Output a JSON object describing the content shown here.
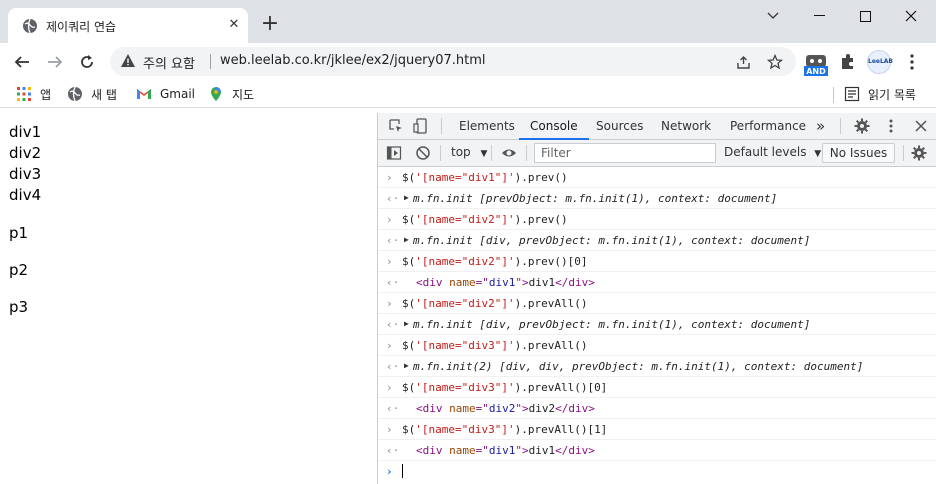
{
  "tab": {
    "title": "제이쿼리 연습"
  },
  "omnibox": {
    "security_label": "주의 요함",
    "url": "web.leelab.co.kr/jklee/ex2/jquery07.html"
  },
  "extensions": {
    "and_label": "AND",
    "profile_label": "LeeLAB"
  },
  "bookmarks": {
    "apps": "앱",
    "newtab": "새 탭",
    "gmail": "Gmail",
    "maps": "지도",
    "reading_list": "읽기 목록"
  },
  "page": {
    "divs": [
      "div1",
      "div2",
      "div3",
      "div4"
    ],
    "paragraphs": [
      "p1",
      "p2",
      "p3"
    ]
  },
  "devtools": {
    "tabs": [
      "Elements",
      "Console",
      "Sources",
      "Network",
      "Performance"
    ],
    "active_tab": "Console",
    "more": "»",
    "context": "top",
    "filter_placeholder": "Filter",
    "levels": "Default levels",
    "issues": "No Issues"
  },
  "console": [
    {
      "kind": "input",
      "a": "$(",
      "s": "'[name=\"div1\"]'",
      "b": ").prev()"
    },
    {
      "kind": "object",
      "text": "m.fn.init [prevObject: m.fn.init(1), context: document]"
    },
    {
      "kind": "input",
      "a": "$(",
      "s": "'[name=\"div2\"]'",
      "b": ").prev()"
    },
    {
      "kind": "object",
      "text": "m.fn.init [div, prevObject: m.fn.init(1), context: document]"
    },
    {
      "kind": "input",
      "a": "$(",
      "s": "'[name=\"div2\"]'",
      "b": ").prev()[0]"
    },
    {
      "kind": "element",
      "open": "<div ",
      "attr": "name",
      "eq": "=\"",
      "val": "div1",
      "close": "\">",
      "content": "div1",
      "end": "</div>"
    },
    {
      "kind": "input",
      "a": "$(",
      "s": "'[name=\"div2\"]'",
      "b": ").prevAll()"
    },
    {
      "kind": "object",
      "text": "m.fn.init [div, prevObject: m.fn.init(1), context: document]"
    },
    {
      "kind": "input",
      "a": "$(",
      "s": "'[name=\"div3\"]'",
      "b": ").prevAll()"
    },
    {
      "kind": "object",
      "text": "m.fn.init(2) [div, div, prevObject: m.fn.init(1), context: document]"
    },
    {
      "kind": "input",
      "a": "$(",
      "s": "'[name=\"div3\"]'",
      "b": ").prevAll()[0]"
    },
    {
      "kind": "element",
      "open": "<div ",
      "attr": "name",
      "eq": "=\"",
      "val": "div2",
      "close": "\">",
      "content": "div2",
      "end": "</div>"
    },
    {
      "kind": "input",
      "a": "$(",
      "s": "'[name=\"div3\"]'",
      "b": ").prevAll()[1]"
    },
    {
      "kind": "element",
      "open": "<div ",
      "attr": "name",
      "eq": "=\"",
      "val": "div1",
      "close": "\">",
      "content": "div1",
      "end": "</div>"
    }
  ],
  "prompt_symbol": "›",
  "result_symbol": "‹·",
  "input_symbol": "›"
}
